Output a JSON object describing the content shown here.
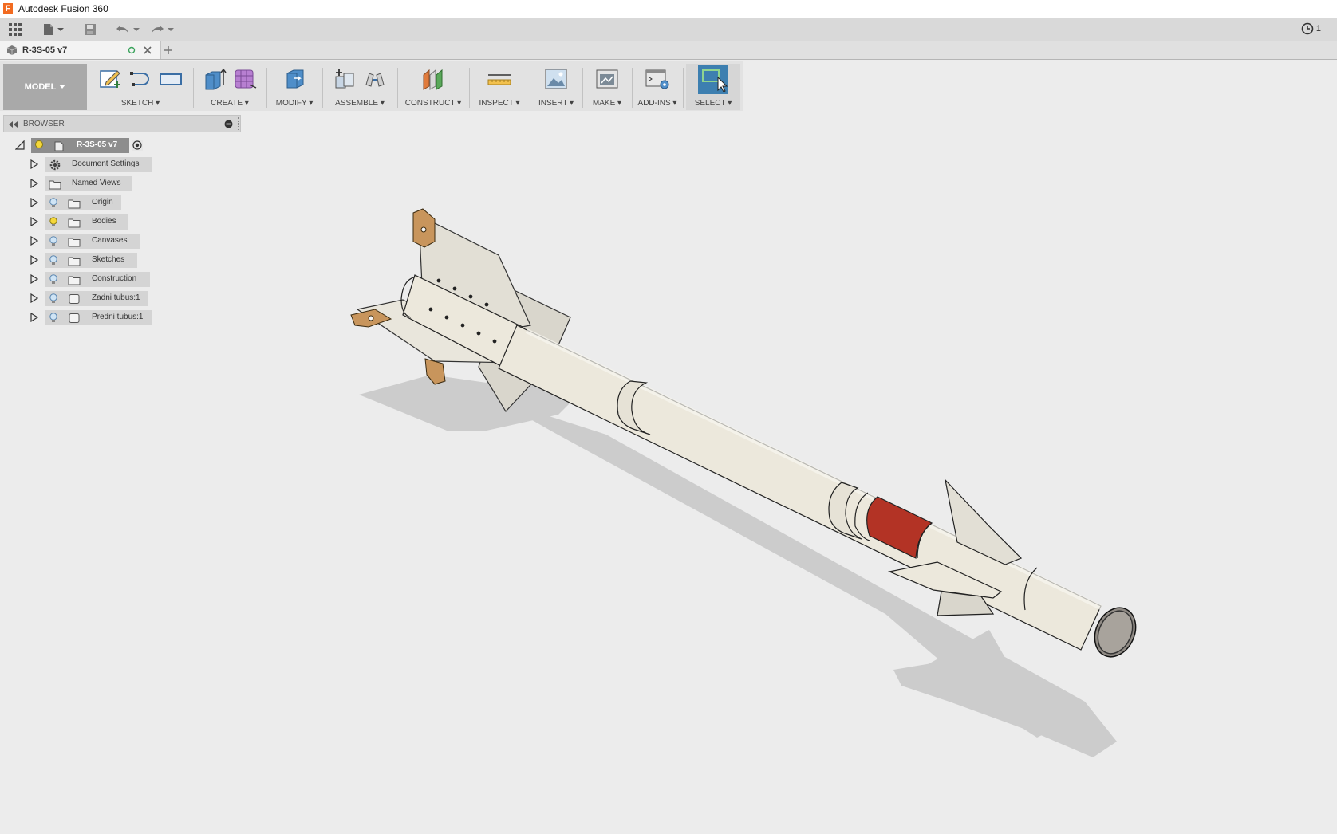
{
  "window": {
    "title": "Autodesk Fusion 360"
  },
  "quick_access": {
    "job_status_count": "1"
  },
  "document_tab": {
    "name": "R-3S-05 v7"
  },
  "toolbar": {
    "workspace": "MODEL",
    "groups": [
      {
        "label": "SKETCH"
      },
      {
        "label": "CREATE"
      },
      {
        "label": "MODIFY"
      },
      {
        "label": "ASSEMBLE"
      },
      {
        "label": "CONSTRUCT"
      },
      {
        "label": "INSPECT"
      },
      {
        "label": "INSERT"
      },
      {
        "label": "MAKE"
      },
      {
        "label": "ADD-INS"
      },
      {
        "label": "SELECT"
      }
    ]
  },
  "browser": {
    "title": "BROWSER",
    "root": {
      "label": "R-3S-05 v7"
    },
    "items": [
      {
        "label": "Document Settings"
      },
      {
        "label": "Named Views"
      },
      {
        "label": "Origin"
      },
      {
        "label": "Bodies"
      },
      {
        "label": "Canvases"
      },
      {
        "label": "Sketches"
      },
      {
        "label": "Construction"
      },
      {
        "label": "Zadni tubus:1"
      },
      {
        "label": "Predni tubus:1"
      }
    ]
  },
  "colors": {
    "missile_body": "#ece8dc",
    "stripe": "#b33325",
    "mount_lugs": "#c8955c",
    "select_accent": "#3d7fb0"
  }
}
